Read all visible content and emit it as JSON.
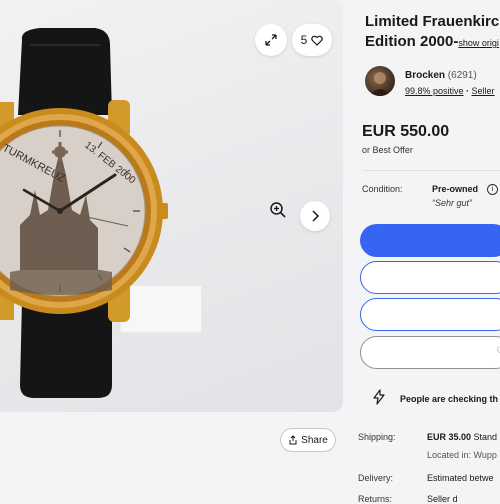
{
  "gallery": {
    "like_count": "5",
    "share_label": "Share",
    "watch_dial": {
      "left_text": "TURMKREUZ",
      "date_text": "13. FEB 2000"
    }
  },
  "listing": {
    "title_line1": "Limited Frauenkirch",
    "title_line2": "Edition 2000-",
    "title_more": "show origi",
    "seller": {
      "name": "Brocken",
      "feedback_count": "(6291)",
      "positive": "99.8% positive",
      "sep": " · ",
      "link": "Seller"
    },
    "price": "EUR 550.00",
    "best_offer": "or Best Offer",
    "condition_label": "Condition:",
    "condition_value": "Pre-owned",
    "condition_note": "“Sehr gut”",
    "watching_text": "People are checking th",
    "shipping_label": "Shipping:",
    "shipping_price": "EUR 35.00",
    "shipping_suffix": " Stand",
    "location": "Located in: Wupp",
    "delivery_label": "Delivery:",
    "delivery_value": "Estimated betwe",
    "returns_label": "Returns:",
    "returns_value": "Seller d"
  },
  "colors": {
    "accent": "#3665f3",
    "gold": "#c98a1e"
  }
}
